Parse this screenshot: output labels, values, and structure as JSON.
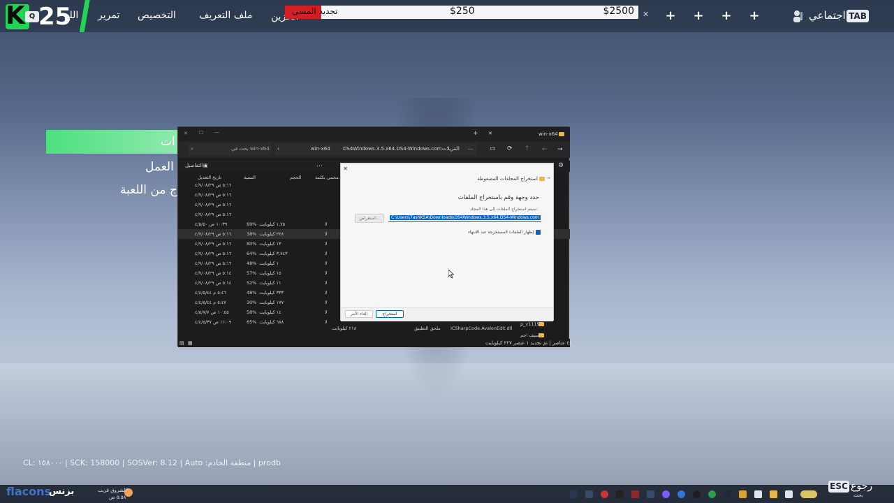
{
  "topbar": {
    "tab_key": "TAB",
    "social": "اجتماعي",
    "nav": {
      "scroll": "تمرير",
      "customize": "التخصيص",
      "profile": "ملف التعريف",
      "store": "الخزين",
      "play": "اللع"
    },
    "price_ticker": {
      "label": "تجديد المسى",
      "price_low": "$250",
      "price_high": "$2500"
    },
    "badge_letter": "Q",
    "badge_number": "25"
  },
  "left_menu": {
    "item1": "ات",
    "item2": "العمل",
    "item3": "ج من اللعبة"
  },
  "explorer": {
    "title": "win-x64",
    "breadcrumb": [
      "التنزيلات",
      "DS4Windows.3.5.x64.DS4-Windows.com",
      "win-x64"
    ],
    "search_placeholder": "بحث في win-x64",
    "details_label": "التفاصيل",
    "columns": [
      "تاريخ التعديل",
      "النسبة",
      "الحجم",
      "محمي بكلمة..."
    ],
    "rows": [
      {
        "date": "٥:١٦ ص ٤/٧/٠٨/٢٩",
        "ratio": "",
        "size": "",
        "prot": ""
      },
      {
        "date": "٥:١٦ ص ٤/٧/٠٨/٢٩",
        "ratio": "",
        "size": "",
        "prot": ""
      },
      {
        "date": "٥:١٦ ص ٤/٧/٠٨/٢٩",
        "ratio": "",
        "size": "",
        "prot": ""
      },
      {
        "date": "٥:١٦ ص ٤/٧/٠٨/٢٩",
        "ratio": "",
        "size": "",
        "prot": ""
      },
      {
        "date": "١٠:٣٩ ص ٤/٥/٥٠",
        "ratio": "69%",
        "size": "١,٧٥ كيلوبايت",
        "prot": "لا"
      },
      {
        "date": "٥:١٦ ص ٤/٧/٠٨/٢٩",
        "ratio": "38%",
        "size": "٢٢٨ كيلوبايت",
        "prot": "لا"
      },
      {
        "date": "٥:١٦ ص ٤/٧/٠٨/٢٩",
        "ratio": "80%",
        "size": "١٣ كيلوبايت",
        "prot": "لا"
      },
      {
        "date": "٥:١٦ ص ٤/٧/٠٨/٢٩",
        "ratio": "64%",
        "size": "٣,٧٤٣ كيلوبايت",
        "prot": "لا"
      },
      {
        "date": "٥:١٦ ص ٤/٧/٠٨/٢٩",
        "ratio": "48%",
        "size": "١ كيلوبايت",
        "prot": "لا"
      },
      {
        "date": "٥:١٤ ص ٤/٧/٠٨/٢٩",
        "ratio": "57%",
        "size": "١٥ كيلوبايت",
        "prot": "لا"
      },
      {
        "date": "٥:١٤ ص ٤/٧/٠٨/٢٩",
        "ratio": "52%",
        "size": "١١ كيلوبايت",
        "prot": "لا"
      },
      {
        "date": "٥:٤٦ م ٤/٤/٥/٤٤",
        "ratio": "48%",
        "size": "٣٣٣ كيلوبايت",
        "prot": "لا"
      },
      {
        "date": "٥:٤٧ م ٤/٤/٥/٤٤",
        "ratio": "30%",
        "size": "١٧٧ كيلوبايت",
        "prot": "لا"
      },
      {
        "date": "١٠:٥٥ ص ٤/٥/٧/٧",
        "ratio": "58%",
        "size": "١٤ كيلوبايت",
        "prot": "لا"
      },
      {
        "date": "١١:٠٩ ص ٤/٤/٥/٣٧",
        "ratio": "65%",
        "size": "٦٨٨ كيلوبايت",
        "prot": "لا"
      }
    ],
    "last_row_name": "ICSharpCode.AvalonEdit.dll",
    "last_row_type": "ملحق التطبيق",
    "last_row_size": "٢١٨ كيلوبايت",
    "side_folder1": "p_v1119",
    "side_folder2": "سيف احم",
    "status": "٤٨ عناصر | تم تحديد ١ عنصر ٢٢٧ كيلوبايت"
  },
  "dialog": {
    "title": "استخراج المجلدات المضغوطة",
    "heading": "حدد وجهة وقم باستخراج الملفات",
    "field_label": "سيتم استخراج الملفات إلى هذا المجلد:",
    "path": "C:\\Users\\7ashKSA\\Downloads\\DS4Windows.3.5.x64.DS4-Windows.com",
    "browse": "استعراض...",
    "checkbox_label": "إظهار الملفات المستخرجة عند الانتهاء",
    "extract": "استخراج",
    "cancel": "إلغاء الأمر"
  },
  "footer": {
    "stats": "CL: ١٥٨٠٠٠ | SCK: 158000 | SOSVer: 8.12 | Auto :منطقة الخادم | prodb",
    "esc_key": "ESC",
    "back": "رجوع",
    "back_sub": "بحث",
    "wordmark": "flacons",
    "clock_time": "الشروق قريب",
    "clock_sub": "٥:٥٨ ص"
  }
}
